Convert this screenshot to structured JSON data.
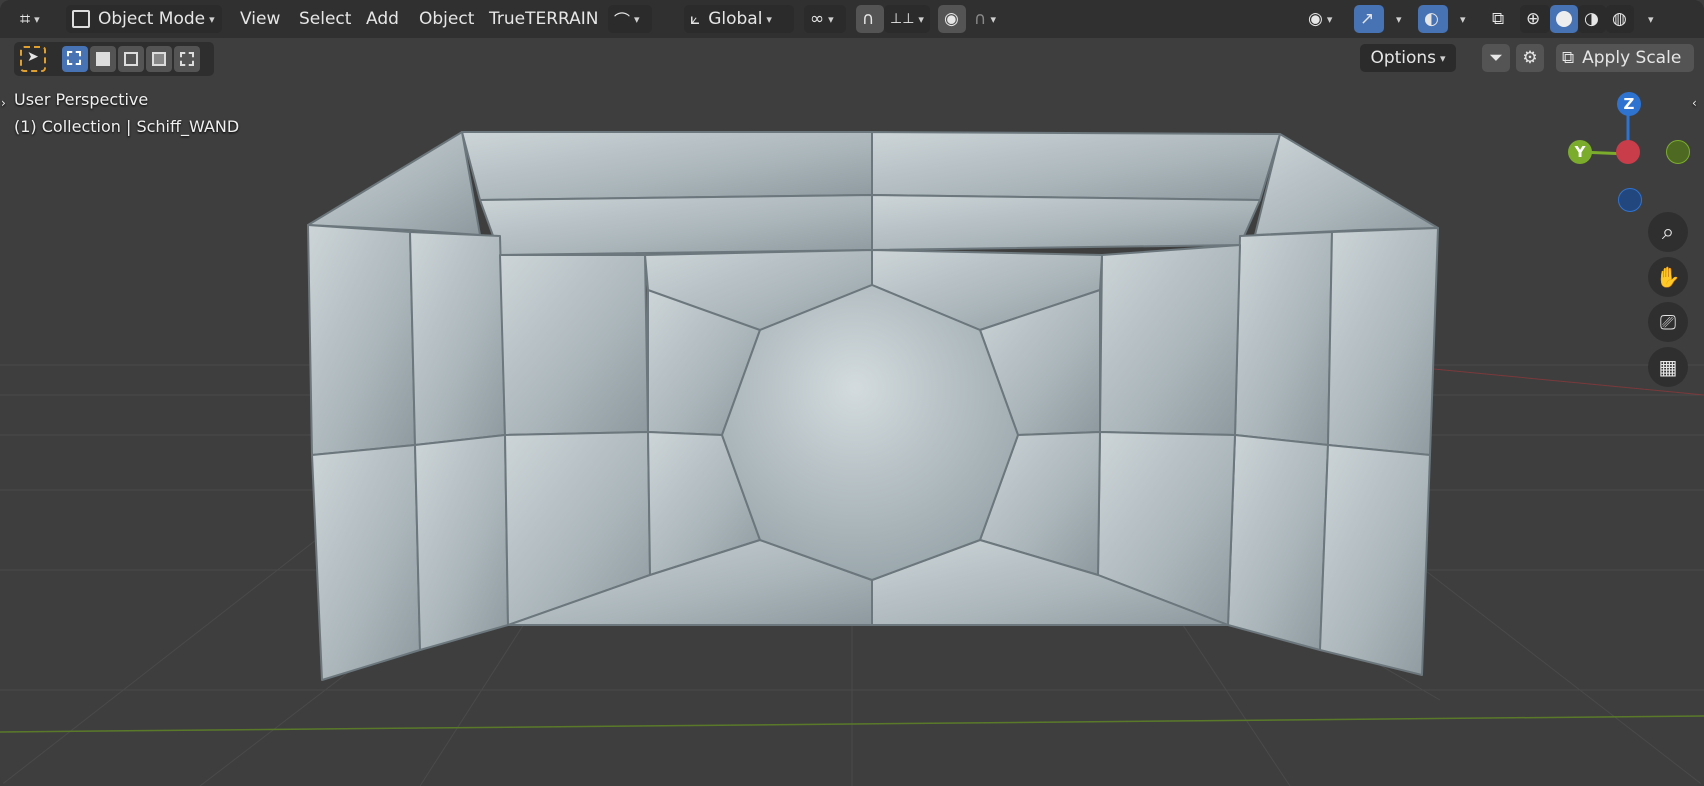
{
  "header": {
    "editor_type_icon": "3d-viewport-icon",
    "mode_label": "Object Mode",
    "menus": [
      "View",
      "Select",
      "Add",
      "Object",
      "TrueTERRAIN"
    ],
    "transform_orientation_label": "Global",
    "shading_modes": [
      "wireframe",
      "solid",
      "material-preview",
      "rendered"
    ],
    "active_shading": "solid"
  },
  "toolbar": {
    "options_label": "Options",
    "apply_scale_label": "Apply Scale"
  },
  "viewport": {
    "view_name": "User Perspective",
    "collection_info": "(1) Collection | Schiff_WAND"
  },
  "gizmo": {
    "z_label": "Z",
    "y_label": "Y",
    "colors": {
      "x": "#c93d4a",
      "y": "#7bac2b",
      "z": "#2f73d1"
    }
  },
  "nav_tools": [
    "zoom-icon",
    "hand-pan-icon",
    "camera-icon",
    "ortho-grid-icon"
  ],
  "colors": {
    "header_bg": "#303030",
    "viewport_bg": "#3e3e3e",
    "accent": "#4772b3",
    "mesh": "#b8c3c7"
  }
}
